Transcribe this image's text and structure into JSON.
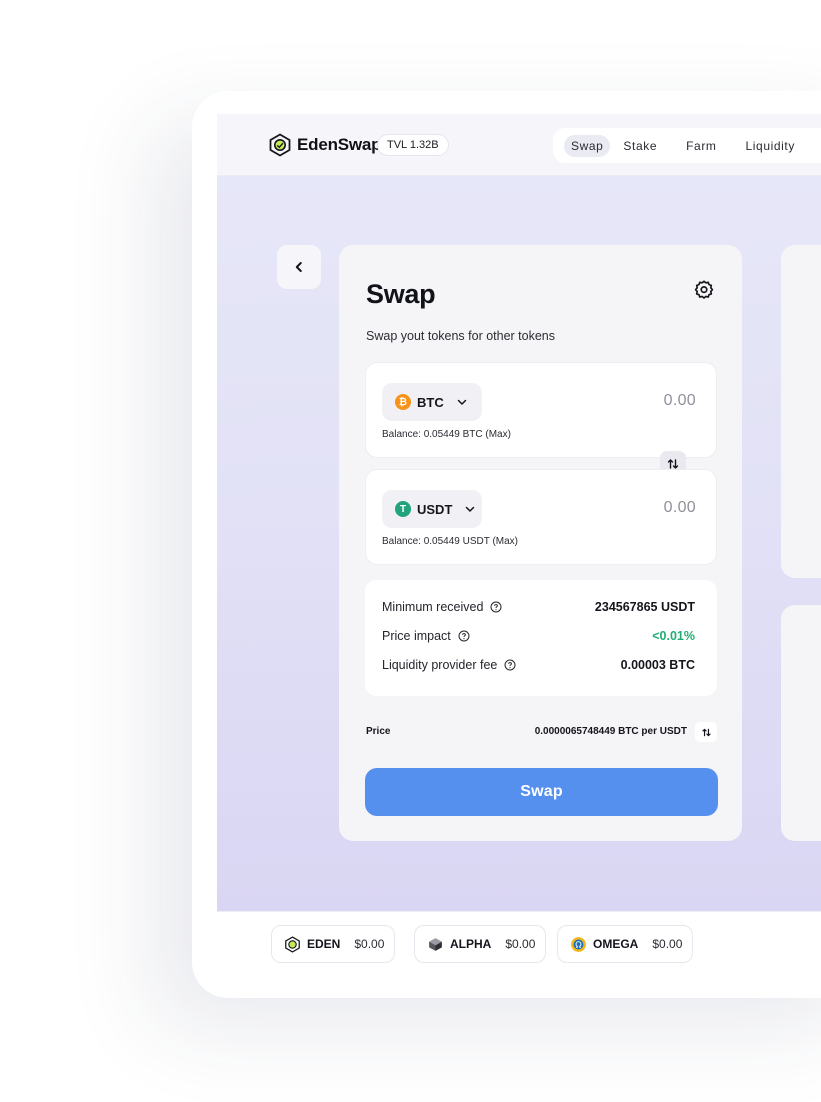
{
  "header": {
    "brand": "EdenSwap",
    "tvl": "TVL 1.32B",
    "nav": [
      {
        "label": "Swap",
        "active": true
      },
      {
        "label": "Stake",
        "active": false
      },
      {
        "label": "Farm",
        "active": false
      },
      {
        "label": "Liquidity",
        "active": false
      }
    ]
  },
  "swap_card": {
    "title": "Swap",
    "subtitle": "Swap yout tokens for other tokens",
    "from": {
      "symbol": "BTC",
      "amount": "0.00",
      "balance": "Balance: 0.05449 BTC (Max)",
      "icon": "bitcoin-icon",
      "color": "#f7931a"
    },
    "to": {
      "symbol": "USDT",
      "amount": "0.00",
      "balance": "Balance: 0.05449 USDT (Max)",
      "icon": "tether-icon",
      "color": "#23a37c"
    },
    "details": [
      {
        "label": "Minimum received",
        "value": "234567865 USDT"
      },
      {
        "label": "Price impact",
        "value": "<0.01%"
      },
      {
        "label": "Liquidity provider fee",
        "value": "0.00003 BTC"
      }
    ],
    "price_label": "Price",
    "price_value": "0.0000065748449 BTC per USDT",
    "swap_button": "Swap"
  },
  "footer": {
    "tokens": [
      {
        "name": "EDEN",
        "price": "$0.00",
        "icon": "eden-logo-icon"
      },
      {
        "name": "ALPHA",
        "price": "$0.00",
        "icon": "alpha-cube-icon"
      },
      {
        "name": "OMEGA",
        "price": "$0.00",
        "icon": "omega-coin-icon"
      }
    ]
  },
  "colors": {
    "accent": "#5590ef",
    "positive": "#1fae72",
    "btc": "#f7931a",
    "usdt": "#23a37c"
  }
}
